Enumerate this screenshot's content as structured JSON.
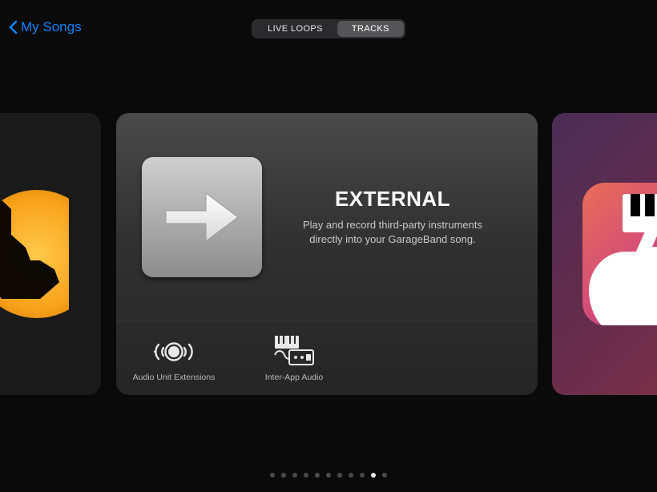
{
  "nav": {
    "back_label": "My Songs"
  },
  "segmented": {
    "items": [
      "LIVE LOOPS",
      "TRACKS"
    ],
    "active_index": 1
  },
  "center_card": {
    "title": "EXTERNAL",
    "description": "Play and record third-party instruments directly into your GarageBand song.",
    "sub_options": [
      {
        "label": "Audio Unit Extensions",
        "icon": "audio-unit-icon"
      },
      {
        "label": "Inter-App Audio",
        "icon": "inter-app-audio-icon"
      }
    ]
  },
  "pager": {
    "total": 11,
    "active_index": 9
  }
}
